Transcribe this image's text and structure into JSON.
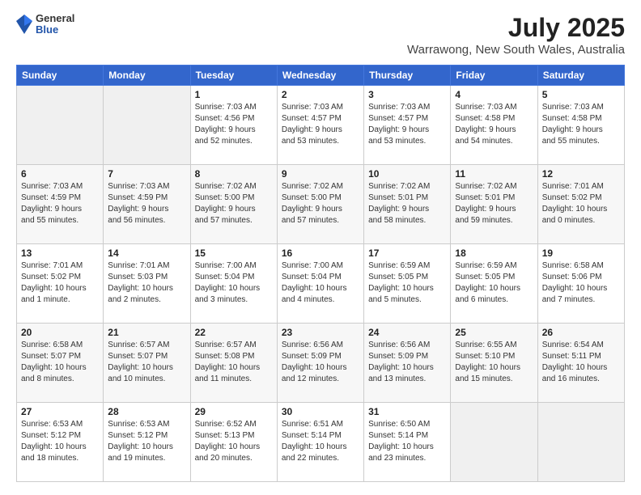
{
  "logo": {
    "general": "General",
    "blue": "Blue"
  },
  "title": "July 2025",
  "subtitle": "Warrawong, New South Wales, Australia",
  "headers": [
    "Sunday",
    "Monday",
    "Tuesday",
    "Wednesday",
    "Thursday",
    "Friday",
    "Saturday"
  ],
  "weeks": [
    [
      {
        "day": "",
        "info": ""
      },
      {
        "day": "",
        "info": ""
      },
      {
        "day": "1",
        "info": "Sunrise: 7:03 AM\nSunset: 4:56 PM\nDaylight: 9 hours\nand 52 minutes."
      },
      {
        "day": "2",
        "info": "Sunrise: 7:03 AM\nSunset: 4:57 PM\nDaylight: 9 hours\nand 53 minutes."
      },
      {
        "day": "3",
        "info": "Sunrise: 7:03 AM\nSunset: 4:57 PM\nDaylight: 9 hours\nand 53 minutes."
      },
      {
        "day": "4",
        "info": "Sunrise: 7:03 AM\nSunset: 4:58 PM\nDaylight: 9 hours\nand 54 minutes."
      },
      {
        "day": "5",
        "info": "Sunrise: 7:03 AM\nSunset: 4:58 PM\nDaylight: 9 hours\nand 55 minutes."
      }
    ],
    [
      {
        "day": "6",
        "info": "Sunrise: 7:03 AM\nSunset: 4:59 PM\nDaylight: 9 hours\nand 55 minutes."
      },
      {
        "day": "7",
        "info": "Sunrise: 7:03 AM\nSunset: 4:59 PM\nDaylight: 9 hours\nand 56 minutes."
      },
      {
        "day": "8",
        "info": "Sunrise: 7:02 AM\nSunset: 5:00 PM\nDaylight: 9 hours\nand 57 minutes."
      },
      {
        "day": "9",
        "info": "Sunrise: 7:02 AM\nSunset: 5:00 PM\nDaylight: 9 hours\nand 57 minutes."
      },
      {
        "day": "10",
        "info": "Sunrise: 7:02 AM\nSunset: 5:01 PM\nDaylight: 9 hours\nand 58 minutes."
      },
      {
        "day": "11",
        "info": "Sunrise: 7:02 AM\nSunset: 5:01 PM\nDaylight: 9 hours\nand 59 minutes."
      },
      {
        "day": "12",
        "info": "Sunrise: 7:01 AM\nSunset: 5:02 PM\nDaylight: 10 hours\nand 0 minutes."
      }
    ],
    [
      {
        "day": "13",
        "info": "Sunrise: 7:01 AM\nSunset: 5:02 PM\nDaylight: 10 hours\nand 1 minute."
      },
      {
        "day": "14",
        "info": "Sunrise: 7:01 AM\nSunset: 5:03 PM\nDaylight: 10 hours\nand 2 minutes."
      },
      {
        "day": "15",
        "info": "Sunrise: 7:00 AM\nSunset: 5:04 PM\nDaylight: 10 hours\nand 3 minutes."
      },
      {
        "day": "16",
        "info": "Sunrise: 7:00 AM\nSunset: 5:04 PM\nDaylight: 10 hours\nand 4 minutes."
      },
      {
        "day": "17",
        "info": "Sunrise: 6:59 AM\nSunset: 5:05 PM\nDaylight: 10 hours\nand 5 minutes."
      },
      {
        "day": "18",
        "info": "Sunrise: 6:59 AM\nSunset: 5:05 PM\nDaylight: 10 hours\nand 6 minutes."
      },
      {
        "day": "19",
        "info": "Sunrise: 6:58 AM\nSunset: 5:06 PM\nDaylight: 10 hours\nand 7 minutes."
      }
    ],
    [
      {
        "day": "20",
        "info": "Sunrise: 6:58 AM\nSunset: 5:07 PM\nDaylight: 10 hours\nand 8 minutes."
      },
      {
        "day": "21",
        "info": "Sunrise: 6:57 AM\nSunset: 5:07 PM\nDaylight: 10 hours\nand 10 minutes."
      },
      {
        "day": "22",
        "info": "Sunrise: 6:57 AM\nSunset: 5:08 PM\nDaylight: 10 hours\nand 11 minutes."
      },
      {
        "day": "23",
        "info": "Sunrise: 6:56 AM\nSunset: 5:09 PM\nDaylight: 10 hours\nand 12 minutes."
      },
      {
        "day": "24",
        "info": "Sunrise: 6:56 AM\nSunset: 5:09 PM\nDaylight: 10 hours\nand 13 minutes."
      },
      {
        "day": "25",
        "info": "Sunrise: 6:55 AM\nSunset: 5:10 PM\nDaylight: 10 hours\nand 15 minutes."
      },
      {
        "day": "26",
        "info": "Sunrise: 6:54 AM\nSunset: 5:11 PM\nDaylight: 10 hours\nand 16 minutes."
      }
    ],
    [
      {
        "day": "27",
        "info": "Sunrise: 6:53 AM\nSunset: 5:12 PM\nDaylight: 10 hours\nand 18 minutes."
      },
      {
        "day": "28",
        "info": "Sunrise: 6:53 AM\nSunset: 5:12 PM\nDaylight: 10 hours\nand 19 minutes."
      },
      {
        "day": "29",
        "info": "Sunrise: 6:52 AM\nSunset: 5:13 PM\nDaylight: 10 hours\nand 20 minutes."
      },
      {
        "day": "30",
        "info": "Sunrise: 6:51 AM\nSunset: 5:14 PM\nDaylight: 10 hours\nand 22 minutes."
      },
      {
        "day": "31",
        "info": "Sunrise: 6:50 AM\nSunset: 5:14 PM\nDaylight: 10 hours\nand 23 minutes."
      },
      {
        "day": "",
        "info": ""
      },
      {
        "day": "",
        "info": ""
      }
    ]
  ]
}
